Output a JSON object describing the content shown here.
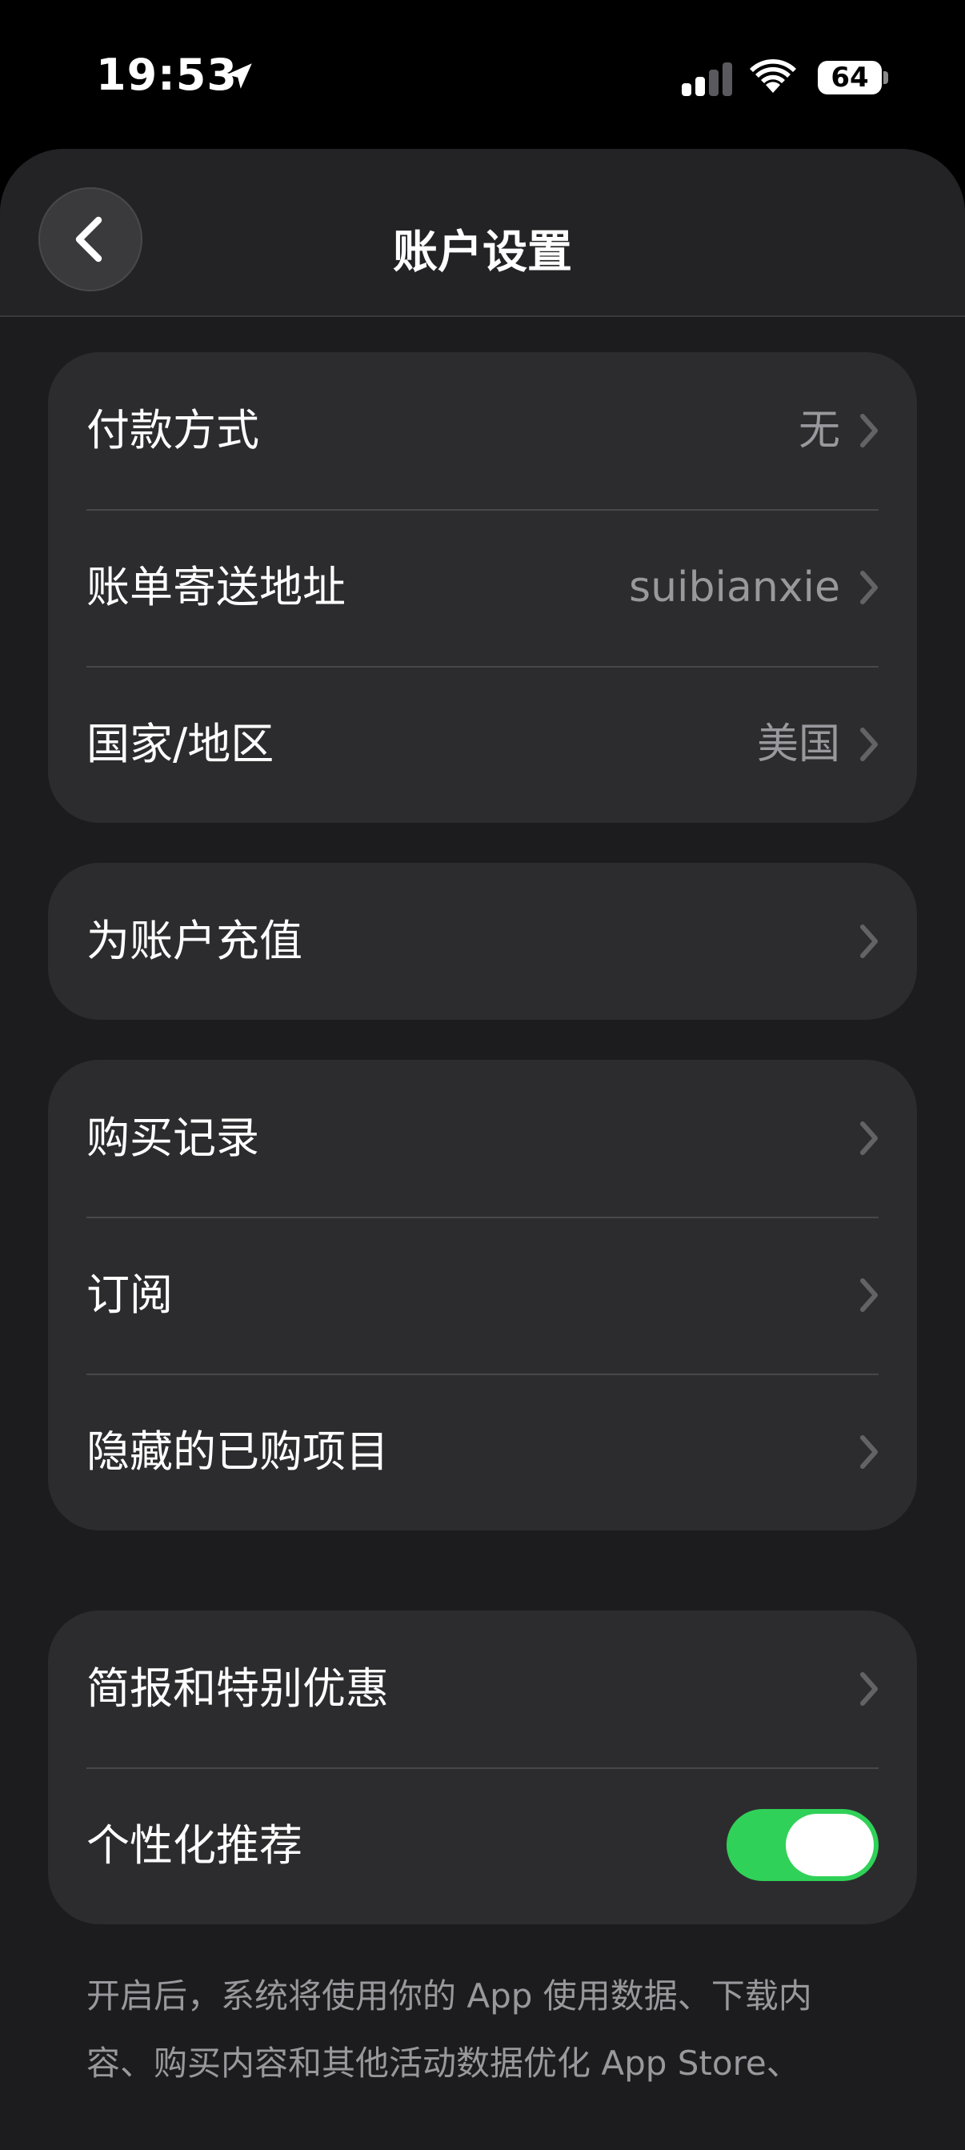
{
  "status": {
    "time": "19:53",
    "battery": "64"
  },
  "nav": {
    "title": "账户设置"
  },
  "groups": {
    "account": [
      {
        "label": "付款方式",
        "value": "无"
      },
      {
        "label": "账单寄送地址",
        "value": "suibianxie"
      },
      {
        "label": "国家/地区",
        "value": "美国"
      }
    ],
    "topup": [
      {
        "label": "为账户充值"
      }
    ],
    "purchases": [
      {
        "label": "购买记录"
      },
      {
        "label": "订阅"
      },
      {
        "label": "隐藏的已购项目"
      }
    ],
    "marketing": [
      {
        "label": "简报和特别优惠"
      },
      {
        "label": "个性化推荐",
        "toggle_on": true
      }
    ]
  },
  "footnote": "开启后，系统将使用你的 App 使用数据、下载内容、购买内容和其他活动数据优化 App Store、",
  "colors": {
    "toggle_on": "#30d158",
    "cell_bg": "#2c2c2e",
    "sheet_bg": "#1c1c1e"
  },
  "icons": [
    "location-arrow-icon",
    "cellular-signal-icon",
    "wifi-icon",
    "battery-icon",
    "back-chevron-icon",
    "chevron-right-icon"
  ]
}
